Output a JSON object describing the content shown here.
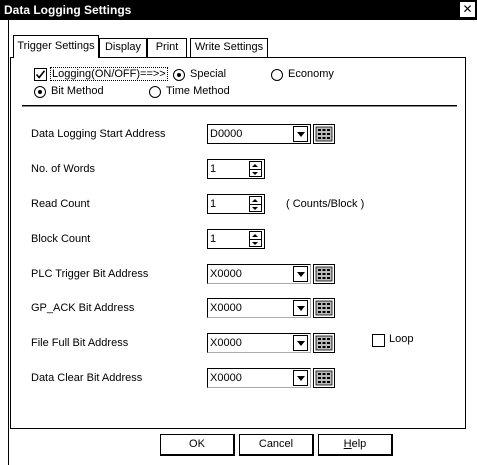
{
  "window": {
    "title": "Data Logging Settings",
    "close_glyph": "✕"
  },
  "tabs": [
    {
      "label": "Trigger Settings",
      "active": true
    },
    {
      "label": "Display",
      "active": false
    },
    {
      "label": "Print",
      "active": false
    },
    {
      "label": "Write Settings",
      "active": false
    }
  ],
  "logging": {
    "checkbox_label": "Logging(ON/OFF)==>>",
    "checked": true,
    "mode_special": "Special",
    "mode_economy": "Economy",
    "selected_mode": "Special",
    "method_bit": "Bit Method",
    "method_time": "Time Method",
    "selected_method": "Bit Method"
  },
  "fields": {
    "start_address": {
      "label": "Data Logging Start Address",
      "value": "D0000"
    },
    "num_words": {
      "label": "No. of Words",
      "value": "1"
    },
    "read_count": {
      "label": "Read Count",
      "value": "1",
      "unit": "( Counts/Block )"
    },
    "block_count": {
      "label": "Block Count",
      "value": "1"
    },
    "plc_trigger": {
      "label": "PLC Trigger Bit Address",
      "value": "X0000"
    },
    "gp_ack": {
      "label": "GP_ACK Bit Address",
      "value": "X0000"
    },
    "file_full": {
      "label": "File Full Bit Address",
      "value": "X0000",
      "loop_label": "Loop",
      "loop_checked": false
    },
    "data_clear": {
      "label": "Data Clear Bit Address",
      "value": "X0000"
    }
  },
  "buttons": {
    "ok": "OK",
    "cancel": "Cancel",
    "help_first": "H",
    "help_rest": "elp"
  },
  "icons": {
    "dropdown": "chevron-down-icon",
    "keypad": "keypad-icon",
    "spinner": "spinner-icon",
    "check": "checkmark-icon"
  }
}
